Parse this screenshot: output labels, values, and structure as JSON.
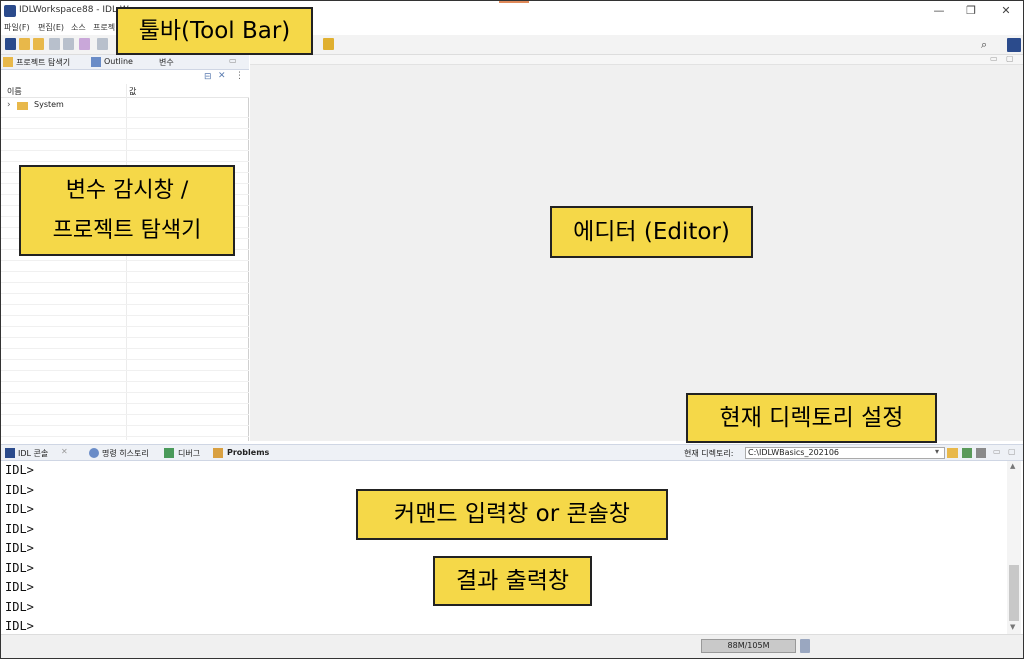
{
  "window": {
    "title": "IDLWorkspace88 - IDL W",
    "minimize": "—",
    "restore": "❐",
    "close": "✕"
  },
  "menu": [
    "파일(F)",
    "편집(E)",
    "소스",
    "프로젝"
  ],
  "left_panel": {
    "tabs": [
      "프로젝트 탐색기",
      "Outline",
      "변수"
    ],
    "columns": {
      "name": "이름",
      "value": "값"
    },
    "tree": [
      {
        "label": "System",
        "expander": "›"
      }
    ]
  },
  "console": {
    "tabs": [
      "IDL 콘솔",
      "명령 히스토리",
      "디버그",
      "Problems"
    ],
    "dir_label": "현재 디렉토리:",
    "dir_value": "C:\\IDLWBasics_202106",
    "prompts": [
      "IDL>",
      "IDL>",
      "IDL>",
      "IDL>",
      "IDL>",
      "IDL>",
      "IDL>",
      "IDL>",
      "IDL>"
    ]
  },
  "status": {
    "memory": "88M/105M"
  },
  "annotations": {
    "toolbar": "툴바(Tool Bar)",
    "left_panel_line1": "변수 감시창 /",
    "left_panel_line2": "프로젝트 탐색기",
    "editor": "에디터 (Editor)",
    "current_dir": "현재 디렉토리 설정",
    "command": "커맨드 입력창 or 콘솔창",
    "output": "결과 출력창"
  },
  "colors": {
    "callout_bg": "#f5d848",
    "editor_bg": "#f0f0f0",
    "tab_bg": "#eef1f6",
    "icon_blue": "#2b4b8c"
  }
}
